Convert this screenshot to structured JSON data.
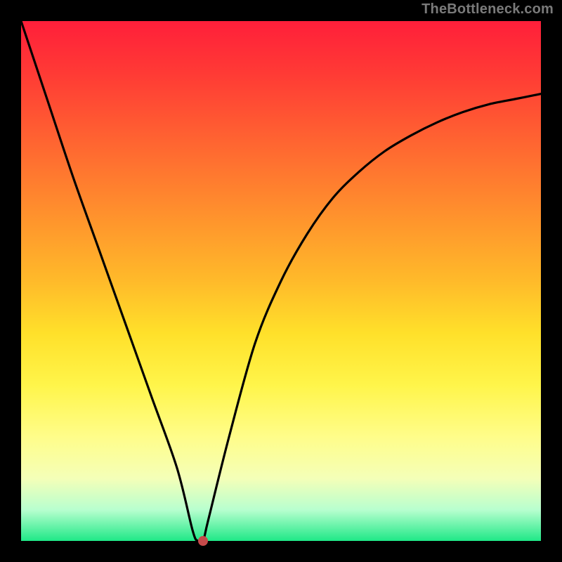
{
  "watermark": "TheBottleneck.com",
  "chart_data": {
    "type": "line",
    "title": "",
    "xlabel": "",
    "ylabel": "",
    "xlim": [
      0,
      100
    ],
    "ylim": [
      0,
      100
    ],
    "grid": false,
    "series": [
      {
        "name": "curve",
        "color": "#000000",
        "x": [
          0,
          5,
          10,
          15,
          20,
          25,
          30,
          33,
          34,
          35,
          36,
          40,
          45,
          50,
          55,
          60,
          65,
          70,
          75,
          80,
          85,
          90,
          95,
          100
        ],
        "y": [
          100,
          85,
          70,
          56,
          42,
          28,
          14,
          2,
          0,
          0,
          4,
          20,
          38,
          50,
          59,
          66,
          71,
          75,
          78,
          80.5,
          82.5,
          84,
          85,
          86
        ]
      }
    ],
    "marker": {
      "x": 35,
      "y": 0,
      "color": "#c54a4a"
    },
    "background_gradient": {
      "direction": "vertical",
      "stops": [
        {
          "pos": 0,
          "color": "#ff1f3a"
        },
        {
          "pos": 50,
          "color": "#ffba2a"
        },
        {
          "pos": 80,
          "color": "#fffd8a"
        },
        {
          "pos": 100,
          "color": "#1fe887"
        }
      ]
    }
  }
}
